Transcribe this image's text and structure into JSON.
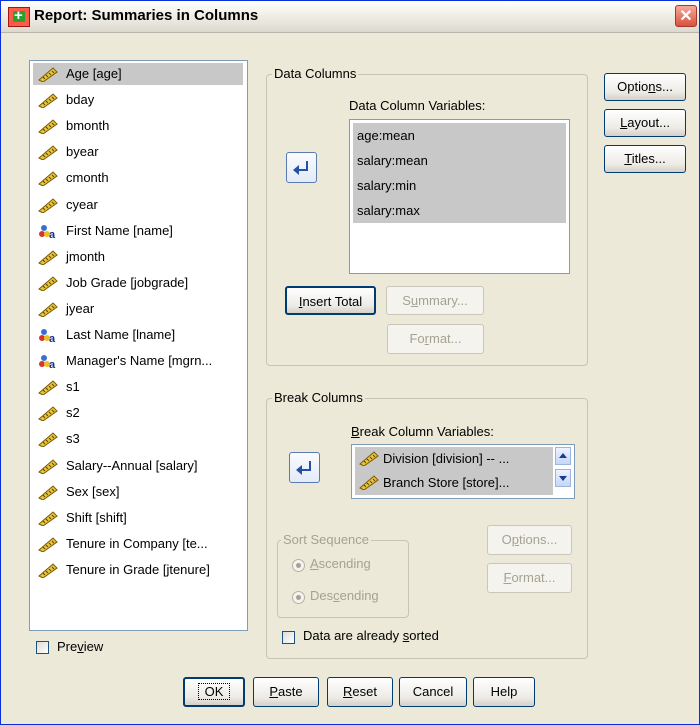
{
  "window": {
    "title": "Report: Summaries in Columns",
    "close_symbol": "✕"
  },
  "variables": [
    {
      "label": "Age [age]",
      "icon": "ruler-icon",
      "selected": true
    },
    {
      "label": "bday",
      "icon": "ruler-icon"
    },
    {
      "label": "bmonth",
      "icon": "ruler-icon"
    },
    {
      "label": "byear",
      "icon": "ruler-icon"
    },
    {
      "label": "cmonth",
      "icon": "ruler-icon"
    },
    {
      "label": "cyear",
      "icon": "ruler-icon"
    },
    {
      "label": "First Name [name]",
      "icon": "nominal-string-icon"
    },
    {
      "label": "jmonth",
      "icon": "ruler-icon"
    },
    {
      "label": "Job Grade [jobgrade]",
      "icon": "ruler-icon"
    },
    {
      "label": "jyear",
      "icon": "ruler-icon"
    },
    {
      "label": "Last Name [lname]",
      "icon": "nominal-string-icon"
    },
    {
      "label": "Manager's Name [mgrn...",
      "icon": "nominal-string-icon"
    },
    {
      "label": "s1",
      "icon": "ruler-icon"
    },
    {
      "label": "s2",
      "icon": "ruler-icon"
    },
    {
      "label": "s3",
      "icon": "ruler-icon"
    },
    {
      "label": "Salary--Annual [salary]",
      "icon": "ruler-icon"
    },
    {
      "label": "Sex [sex]",
      "icon": "ruler-icon"
    },
    {
      "label": "Shift [shift]",
      "icon": "ruler-icon"
    },
    {
      "label": "Tenure in Company [te...",
      "icon": "ruler-icon"
    },
    {
      "label": "Tenure in Grade [jtenure]",
      "icon": "ruler-icon"
    }
  ],
  "preview": {
    "pre": "Pre",
    "u": "v",
    "post": "iew"
  },
  "data_columns": {
    "legend": "Data Columns",
    "list_label": "Data Column Variables:",
    "items": [
      "age:mean",
      "salary:mean",
      "salary:min",
      "salary:max"
    ],
    "insert_total": {
      "u": "I",
      "post": "nsert Total"
    },
    "summary": {
      "pre": "S",
      "u": "u",
      "post": "mmary..."
    },
    "format": {
      "pre": "Fo",
      "u": "r",
      "post": "mat..."
    }
  },
  "break_columns": {
    "legend": "Break Columns",
    "list_label": {
      "u": "B",
      "post": "reak Column Variables:"
    },
    "items": [
      "Division [division] -- ...",
      "Branch Store [store]..."
    ],
    "sort_legend": "Sort Sequence",
    "ascending": {
      "u": "A",
      "post": "scending"
    },
    "descending": {
      "pre": "Des",
      "u": "c",
      "post": "ending"
    },
    "options": {
      "pre": "O",
      "u": "p",
      "post": "tions..."
    },
    "format": {
      "u": "F",
      "post": "ormat..."
    },
    "already_sorted": {
      "pre": "Data are already ",
      "u": "s",
      "post": "orted"
    }
  },
  "side_buttons": {
    "options": {
      "pre": "Optio",
      "u": "n",
      "post": "s..."
    },
    "layout": {
      "u": "L",
      "post": "ayout..."
    },
    "titles": {
      "u": "T",
      "post": "itles..."
    }
  },
  "bottom_buttons": {
    "ok": "OK",
    "paste": {
      "u": "P",
      "post": "aste"
    },
    "reset": {
      "u": "R",
      "post": "eset"
    },
    "cancel": "Cancel",
    "help": "Help"
  },
  "colors": {
    "title_bar": "#e8e6dc",
    "dialog_bg": "#ece9d8",
    "selection": "#c8c8c8",
    "close_button": "#d9513b"
  }
}
